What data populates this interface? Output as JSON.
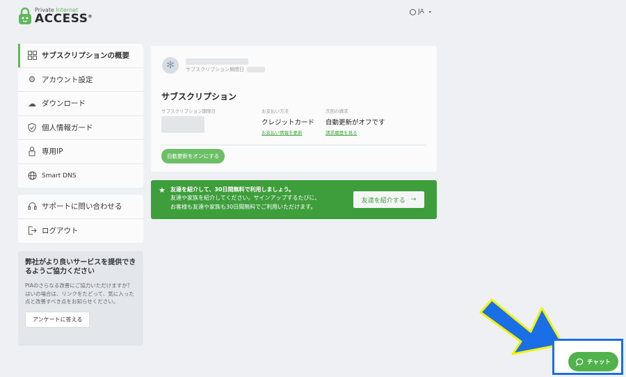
{
  "logo": {
    "small_a": "Private",
    "small_b": "Internet",
    "big": "ACCESS",
    "mark": "®"
  },
  "header": {
    "language": "JA"
  },
  "sidebar": {
    "items": [
      {
        "label": "サブスクリプションの概要",
        "icon": "grid-icon"
      },
      {
        "label": "アカウント設定",
        "icon": "gear-icon"
      },
      {
        "label": "ダウンロード",
        "icon": "cloud-download-icon"
      },
      {
        "label": "個人情報ガード",
        "icon": "shield-icon"
      },
      {
        "label": "専用IP",
        "icon": "dedicated-ip-icon"
      },
      {
        "label": "Smart DNS",
        "icon": "dns-globe-icon"
      }
    ],
    "secondary": [
      {
        "label": "サポートに問い合わせる",
        "icon": "headset-icon"
      },
      {
        "label": "ログアウト",
        "icon": "logout-icon"
      }
    ],
    "feedback": {
      "title": "弊社がより良いサービスを提供できるようご協力ください",
      "text": "PIAのさらなる改善にご協力いただけますか？はいの場合は、リンクをたどって、気に入った点と改善すべき点をお知らせください。",
      "button": "アンケートに答える"
    }
  },
  "subscription": {
    "created_label": "サブスクリプション期間日",
    "title": "サブスクリプション",
    "col1_label": "サブスクリプション期限日",
    "col2_label": "お支払い方法",
    "col2_value": "クレジットカード",
    "col2_link": "お支払い情報を更新",
    "col3_label": "次回の請求",
    "col3_value": "自動更新がオフです",
    "col3_link": "請求履歴を見る",
    "renew_button": "自動更新をオンにする"
  },
  "referral": {
    "line1": "友達を紹介して、30日間無料で利用しましょう。",
    "line2": "友達や家族を紹介してください。サインアップするたびに、",
    "line3": "お客様も友達や家族も30日間無料でご利用いただけます。",
    "button": "友達を紹介する"
  },
  "chat": {
    "label": "チャット"
  },
  "colors": {
    "accent": "#5fb85a",
    "referral_bg": "#3e9e3b",
    "highlight_border": "#1a6fe6",
    "arrow_fill": "#1a6fe6",
    "arrow_stroke": "#f2f200"
  }
}
